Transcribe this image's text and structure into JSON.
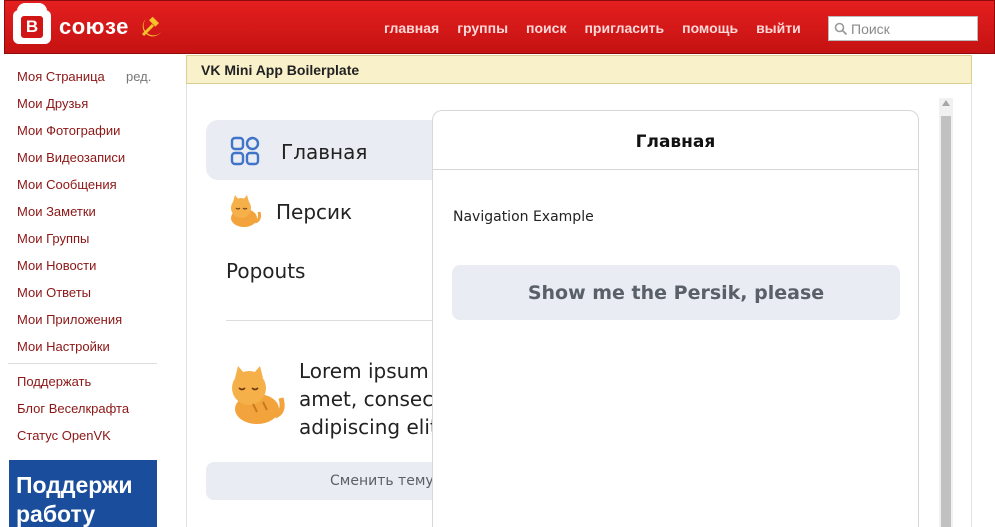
{
  "header": {
    "logo_letter": "В",
    "logo_text": "союзе",
    "nav": [
      "главная",
      "группы",
      "поиск",
      "пригласить",
      "помощь",
      "выйти"
    ],
    "search_placeholder": "Поиск"
  },
  "sidebar": {
    "items": [
      "Моя Страница",
      "Мои Друзья",
      "Мои Фотографии",
      "Мои Видеозаписи",
      "Мои Сообщения",
      "Мои Заметки",
      "Мои Группы",
      "Мои Новости",
      "Мои Ответы",
      "Мои Приложения",
      "Мои Настройки"
    ],
    "edit_label": "ред.",
    "extra_items": [
      "Поддержать",
      "Блог Веселкрафта",
      "Статус OpenVK"
    ],
    "banner_text": "Поддержи работу"
  },
  "app": {
    "title": "VK Mini App Boilerplate",
    "left_nav": {
      "main_label": "Главная",
      "persik_label": "Персик",
      "popouts_label": "Popouts",
      "lorem_lines": [
        "Lorem ipsum d",
        "amet, consecte",
        "adipiscing elit."
      ],
      "theme_button": "Сменить тему"
    },
    "panel": {
      "title": "Главная",
      "caption": "Navigation Example",
      "button_label": "Show me the Persik, please"
    }
  },
  "colors": {
    "header_red": "#d01515",
    "link": "#8c1616",
    "banner_blue": "#1a4e9c",
    "app_header_bg": "#f8f1c9"
  }
}
